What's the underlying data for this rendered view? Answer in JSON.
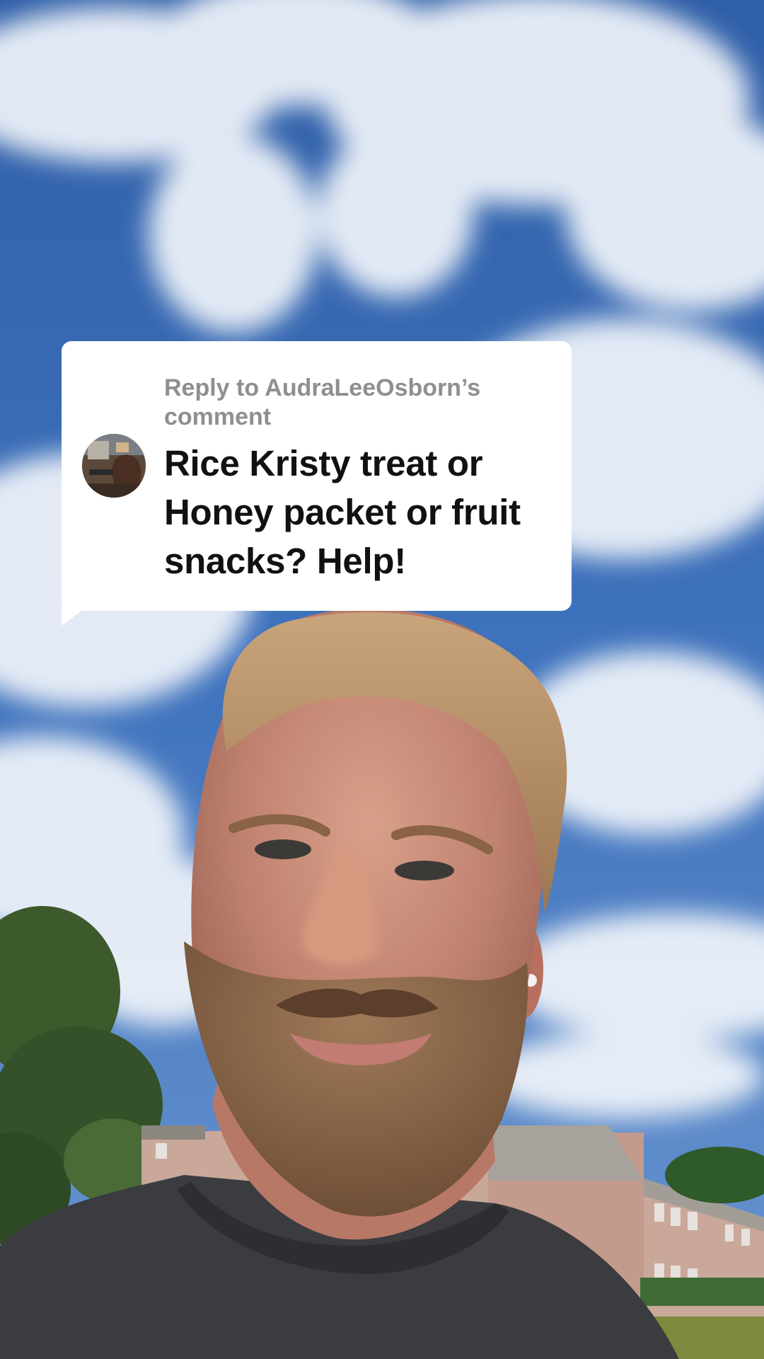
{
  "reply_sticker": {
    "header": "Reply to AudraLeeOsborn’s comment",
    "comment": "Rice Kristy treat or Honey packet or fruit snacks? Help!"
  },
  "icons": {
    "avatar": "commenter-avatar-photo"
  },
  "colors": {
    "sticker_bg": "#ffffff",
    "header_text": "#8f8f8f",
    "comment_text": "#111111",
    "sky": "#3d6fb8"
  }
}
